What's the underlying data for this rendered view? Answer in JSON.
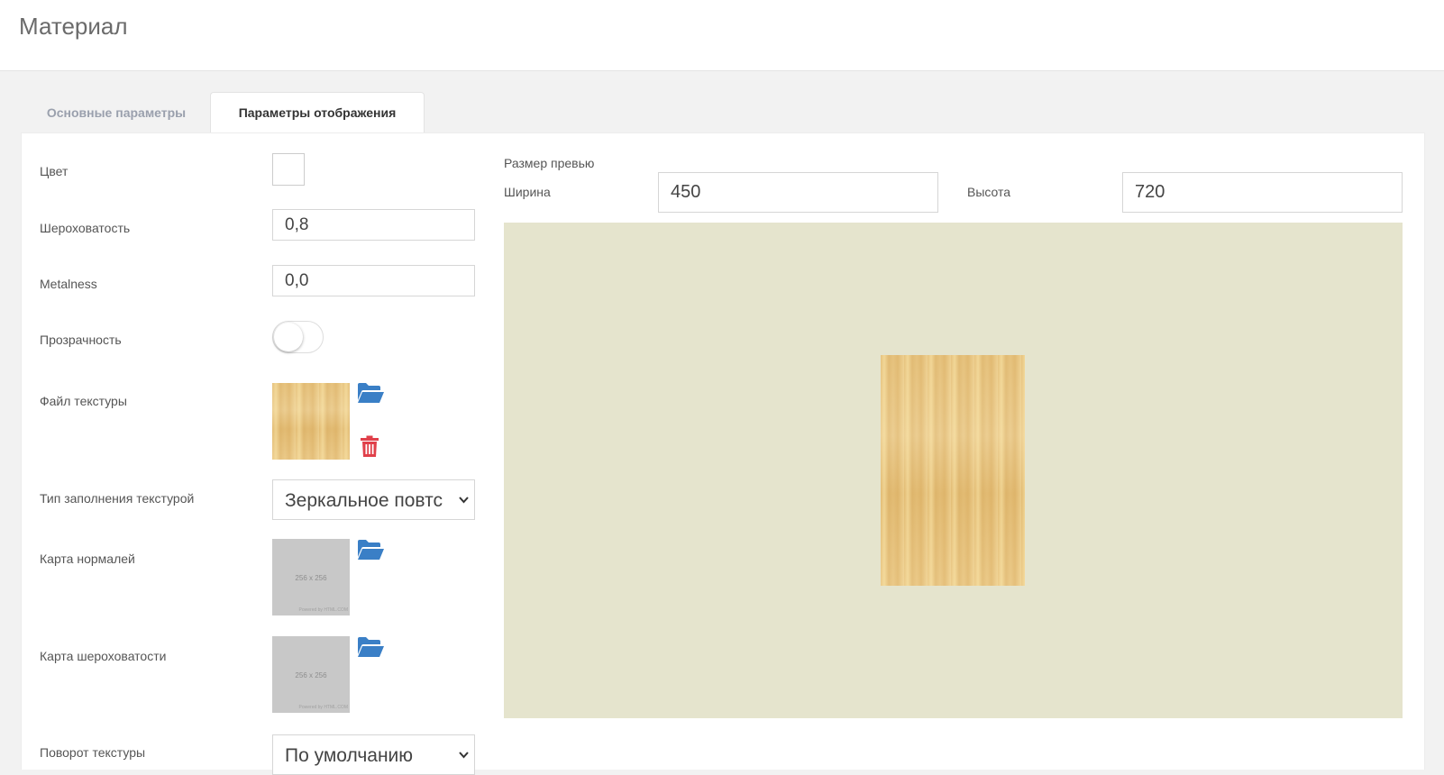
{
  "page": {
    "title": "Материал"
  },
  "tabs": [
    {
      "label": "Основные параметры",
      "active": false
    },
    {
      "label": "Параметры отображения",
      "active": true
    }
  ],
  "form": {
    "color": {
      "label": "Цвет",
      "value": "#ffffff"
    },
    "roughness": {
      "label": "Шероховатость",
      "value": "0,8"
    },
    "metalness": {
      "label": "Metalness",
      "value": "0,0"
    },
    "transparency": {
      "label": "Прозрачность",
      "enabled": false
    },
    "texture_file": {
      "label": "Файл текстуры",
      "open_icon": "folder-open-icon",
      "delete_icon": "trash-icon"
    },
    "fill_type": {
      "label": "Тип заполнения текстурой",
      "value": "Зеркальное повтс"
    },
    "normal_map": {
      "label": "Карта нормалей",
      "placeholder_size": "256 x 256",
      "placeholder_credit": "Powered by HTML.COM",
      "open_icon": "folder-open-icon"
    },
    "roughness_map": {
      "label": "Карта шероховатости",
      "placeholder_size": "256 x 256",
      "placeholder_credit": "Powered by HTML.COM",
      "open_icon": "folder-open-icon"
    },
    "rotation": {
      "label": "Поворот текстуры",
      "value": "По умолчанию"
    }
  },
  "preview": {
    "section_label": "Размер превью",
    "width_label": "Ширина",
    "width_value": "450",
    "height_label": "Высота",
    "height_value": "720",
    "background": "#e5e4cd"
  },
  "colors": {
    "accent_blue": "#3a7fc6",
    "danger_red": "#e0404a",
    "tab_inactive": "#9aa0ad"
  }
}
